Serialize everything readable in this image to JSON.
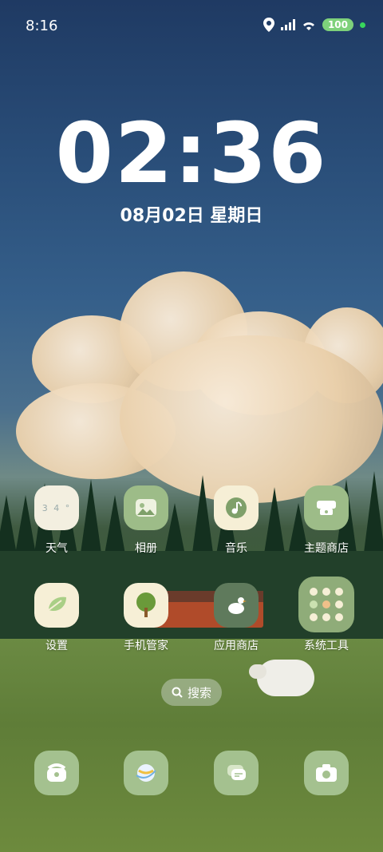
{
  "status_bar": {
    "time": "8:16",
    "battery": "100"
  },
  "lockscreen": {
    "clock": "02:36",
    "date": "08月02日 星期日"
  },
  "apps_row1": [
    {
      "label": "天气",
      "icon": "weather-icon",
      "text": "3 4 °"
    },
    {
      "label": "相册",
      "icon": "gallery-icon"
    },
    {
      "label": "音乐",
      "icon": "music-icon"
    },
    {
      "label": "主题商店",
      "icon": "theme-store-icon"
    }
  ],
  "apps_row2": [
    {
      "label": "设置",
      "icon": "settings-icon"
    },
    {
      "label": "手机管家",
      "icon": "phone-manager-icon"
    },
    {
      "label": "应用商店",
      "icon": "app-store-icon"
    },
    {
      "label": "系统工具",
      "icon": "system-tools-folder-icon"
    }
  ],
  "search": {
    "label": "搜索"
  },
  "dock": [
    "phone-icon",
    "browser-icon",
    "messages-icon",
    "camera-icon"
  ],
  "colors": {
    "icon_green": "#9dbc88",
    "icon_cream": "#f6efd6",
    "folder_green": "#8fac79"
  }
}
